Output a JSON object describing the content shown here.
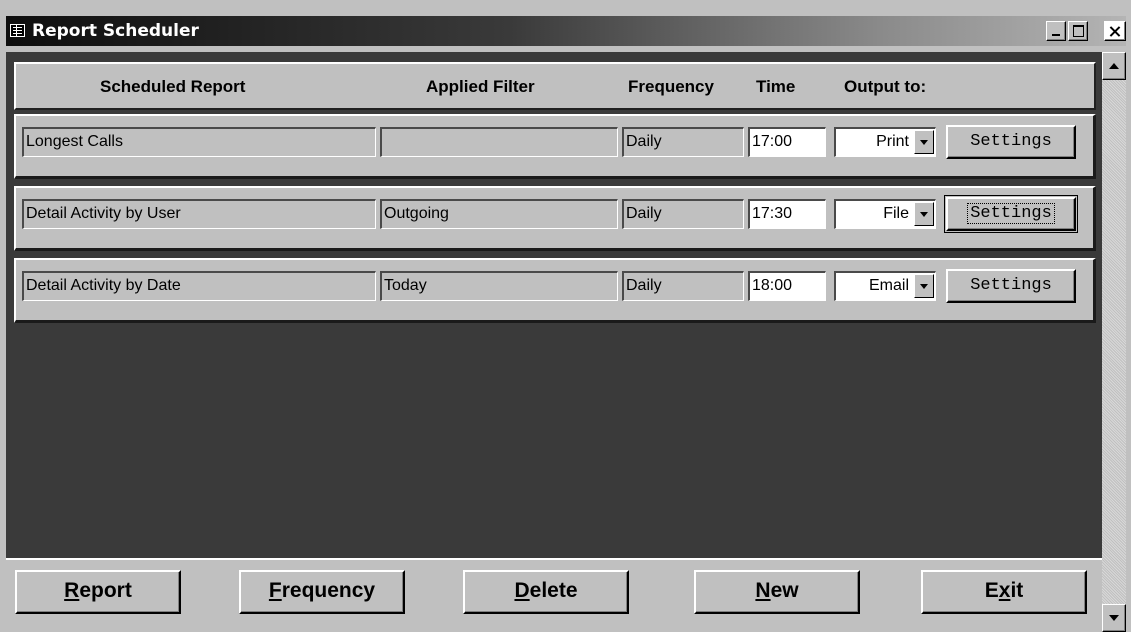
{
  "window": {
    "title": "Report Scheduler"
  },
  "header": {
    "col_report": "Scheduled Report",
    "col_filter": "Applied Filter",
    "col_frequency": "Frequency",
    "col_time": "Time",
    "col_output": "Output to:"
  },
  "rows": [
    {
      "report": "Longest Calls",
      "filter": "",
      "frequency": "Daily",
      "time": "17:00",
      "output": "Print",
      "settings": "Settings"
    },
    {
      "report": "Detail Activity by User",
      "filter": "Outgoing",
      "frequency": "Daily",
      "time": "17:30",
      "output": "File",
      "settings": "Settings"
    },
    {
      "report": "Detail Activity by Date",
      "filter": "Today",
      "frequency": "Daily",
      "time": "18:00",
      "output": "Email",
      "settings": "Settings"
    }
  ],
  "footer": {
    "report": {
      "mnemonic": "R",
      "rest": "eport"
    },
    "frequency": {
      "mnemonic": "F",
      "rest": "requency"
    },
    "delete": {
      "mnemonic": "D",
      "rest": "elete"
    },
    "new": {
      "mnemonic": "N",
      "rest": "ew"
    },
    "exit": {
      "pre": "E",
      "mnemonic": "x",
      "rest": "it"
    }
  },
  "colors": {
    "face": "#c0c0c0",
    "background": "#3a3a3a",
    "title_start": "#0e0e0e",
    "title_end": "#b4b4b4"
  },
  "icons": [
    "form-icon",
    "minimize-icon",
    "maximize-icon",
    "close-icon",
    "dropdown-arrow-icon",
    "scroll-up-icon",
    "scroll-down-icon"
  ]
}
